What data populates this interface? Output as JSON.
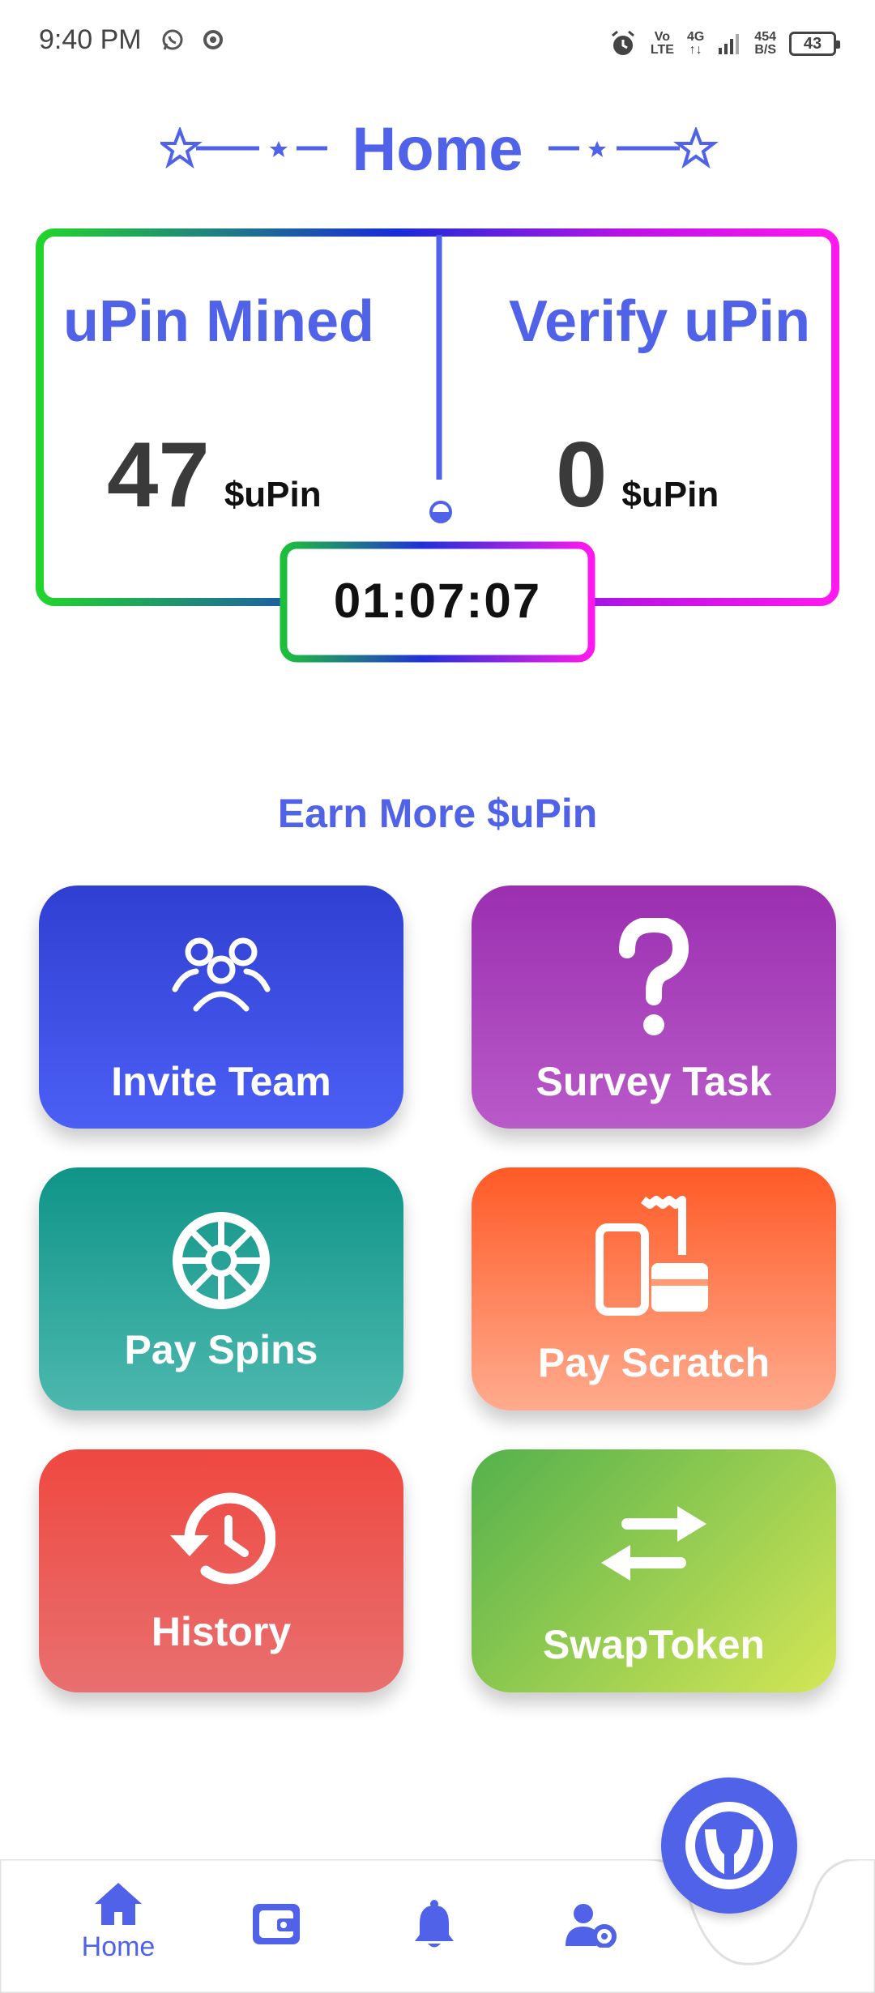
{
  "status_bar": {
    "time": "9:40 PM",
    "volte_top": "Vo",
    "volte_bottom": "LTE",
    "network": "4G",
    "speed_top": "454",
    "speed_bottom": "B/S",
    "battery": "43"
  },
  "header": {
    "title": "Home"
  },
  "stats": {
    "mined_label": "uPin Mined",
    "mined_value": "47",
    "mined_unit": "$uPin",
    "verify_label": "Verify uPin",
    "verify_value": "0",
    "verify_unit": "$uPin",
    "timer": "01:07:07"
  },
  "earn": {
    "title": "Earn More $uPin",
    "tiles": [
      {
        "label": "Invite Team",
        "icon": "team-icon",
        "colors": [
          "#2f3fd1",
          "#4c5ff5"
        ]
      },
      {
        "label": "Survey Task",
        "icon": "question-icon",
        "colors": [
          "#9b2fb0",
          "#b95ac9"
        ]
      },
      {
        "label": "Pay Spins",
        "icon": "spin-wheel-icon",
        "colors": [
          "#0f9488",
          "#4db8ae"
        ]
      },
      {
        "label": "Pay Scratch",
        "icon": "scratch-card-icon",
        "colors": [
          "#ff5a26",
          "#ffab8e"
        ]
      },
      {
        "label": "History",
        "icon": "history-icon",
        "colors": [
          "#ef4840",
          "#e87070"
        ]
      },
      {
        "label": "SwapToken",
        "icon": "swap-icon",
        "colors": [
          "#54b14c",
          "#d4e656"
        ]
      }
    ]
  },
  "bottom_nav": {
    "home_label": "Home",
    "items": [
      "home-icon",
      "wallet-icon",
      "bell-icon",
      "user-settings-icon"
    ]
  },
  "colors": {
    "accent": "#4f62e8",
    "dark_text": "#3a3a3a"
  }
}
